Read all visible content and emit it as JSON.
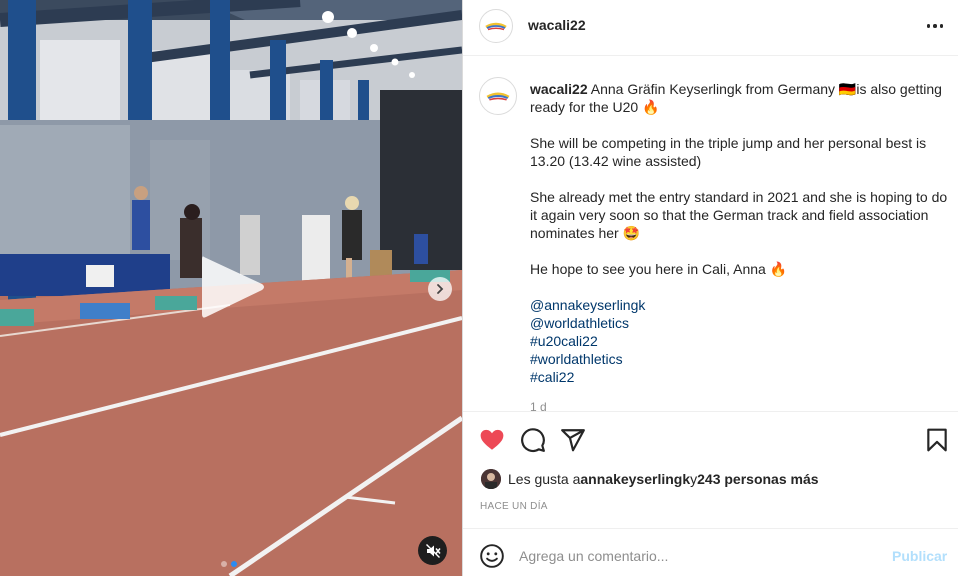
{
  "post": {
    "username": "wacali22",
    "caption": {
      "username": "wacali22",
      "line1": " Anna Gräfin Keyserlingk from Germany 🇩🇪is also getting ready for the U20 🔥",
      "line2": "She will be competing in the triple jump and her personal best is 13.20 (13.42 wine assisted)",
      "line3": "She already met the entry standard in 2021 and she is hoping to do it again very soon so that the German track and field association nominates her 🤩",
      "line4": "He hope to see you here in Cali, Anna 🔥",
      "tags": [
        "@annakeyserlingk",
        "@worldathletics",
        "#u20cali22",
        "#worldathletics",
        "#cali22"
      ],
      "time": "1 d"
    },
    "likes": {
      "prefix": "Les gusta a ",
      "user": "annakeyserlingk",
      "mid": " y ",
      "others": "243 personas más"
    },
    "posted_ago": "HACE UN DÍA",
    "comment": {
      "placeholder": "Agrega un comentario...",
      "post_label": "Publicar"
    }
  },
  "media": {
    "slides": 2,
    "active_slide": 1
  },
  "colors": {
    "like_red": "#ed4956",
    "link_blue": "#00376b",
    "post_disabled": "#b2dffc",
    "track": "#b87060"
  },
  "icons": [
    "more-icon",
    "heart-icon",
    "comment-icon",
    "share-icon",
    "bookmark-icon",
    "emoji-icon",
    "play-icon",
    "chevron-right-icon",
    "mute-icon"
  ]
}
